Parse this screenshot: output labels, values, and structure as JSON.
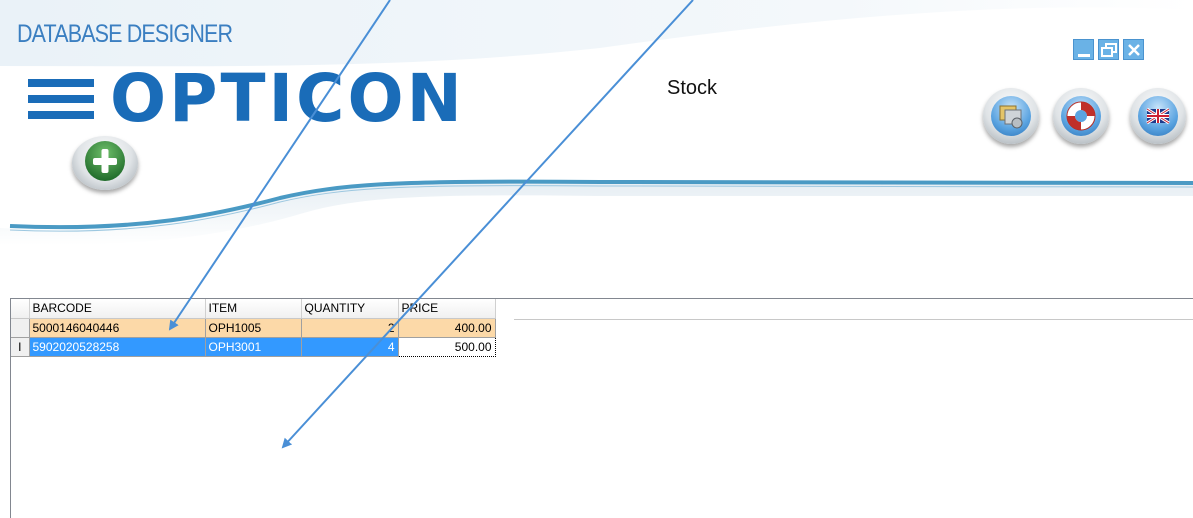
{
  "app": {
    "title": "DATABASE DESIGNER",
    "logo_text": "OPTICON",
    "screen_title": "Stock"
  },
  "window_controls": [
    "minimize-icon",
    "restore-icon",
    "close-icon"
  ],
  "toolbar": {
    "buttons": [
      "database-settings-icon",
      "help-lifebuoy-icon",
      "language-flag-uk-icon"
    ],
    "add_button": "add-plus-icon"
  },
  "grid": {
    "columns": [
      "BARCODE",
      "ITEM",
      "QUANTITY",
      "PRICE"
    ],
    "rows": [
      {
        "barcode": "5000146040446",
        "item": "OPH1005",
        "quantity": "2",
        "price": "400.00",
        "state": "highlighted"
      },
      {
        "barcode": "5902020528258",
        "item": "OPH3001",
        "quantity": "4",
        "price": "500.00",
        "state": "selected-editing"
      }
    ],
    "row_indicator": "I"
  },
  "colors": {
    "brand_blue": "#1a6cb8",
    "title_blue": "#3b7fc1",
    "wave_blue": "#4a9ac4",
    "row_highlight": "#fcd9a8",
    "row_selected": "#3399ff",
    "annotation_arrow": "#4a8fd6"
  }
}
